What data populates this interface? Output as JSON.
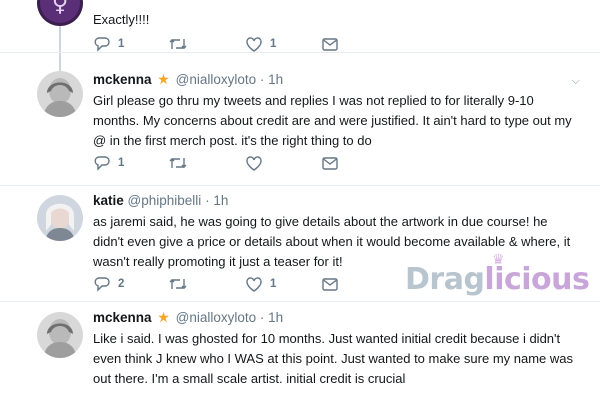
{
  "tweets": [
    {
      "name": "",
      "handle": "",
      "time": "",
      "text": "Exactly!!!!",
      "replies": "1",
      "retweets": "",
      "likes": "1"
    },
    {
      "name": "mckenna",
      "handle": "@nialloxyloto",
      "time": "1h",
      "text": "Girl please go thru my tweets and replies I was not replied to for literally 9-10 months. My concerns about credit are and were justified. It ain't hard to type out my @ in the first merch post. it's the right thing to do",
      "replies": "1",
      "retweets": "",
      "likes": ""
    },
    {
      "name": "katie",
      "handle": "@phiphibelli",
      "time": "1h",
      "text": "as jaremi said, he was going to give details about the artwork in due course! he didn't even give a price or details about when it would become available & where, it wasn't really promoting it just a teaser for it!",
      "replies": "2",
      "retweets": "",
      "likes": "1"
    },
    {
      "name": "mckenna",
      "handle": "@nialloxyloto",
      "time": "1h",
      "text": "Like i said. I was ghosted for 10 months. Just wanted initial credit because i didn't even think J knew who I WAS at this point. Just wanted to make sure my name was out there. I'm a small scale artist. initial credit is crucial",
      "replies": "",
      "retweets": "",
      "likes": ""
    }
  ],
  "separator": "·",
  "watermark": {
    "part1": "Drag",
    "part2": "licious"
  },
  "icons": {
    "reply": "reply-icon",
    "retweet": "retweet-icon",
    "like": "heart-icon",
    "dm": "envelope-icon",
    "verified_star": "star-icon",
    "more": "chevron-down-icon"
  },
  "colors": {
    "text": "#14171a",
    "muted": "#657786",
    "star": "#f5a623",
    "divider": "#e6ecf0"
  }
}
